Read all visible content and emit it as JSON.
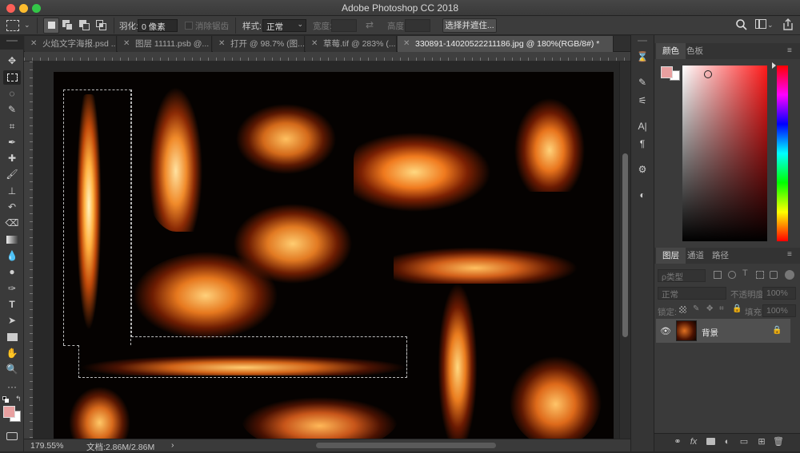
{
  "app": {
    "window_title": "Adobe Photoshop CC 2018",
    "traffic_lights": {
      "close": "#fc5f57",
      "minimize": "#fdbc2e",
      "zoom": "#33c748"
    }
  },
  "options_bar": {
    "feather_label": "羽化:",
    "feather_value": "0 像素",
    "antialias_label": "消除锯齿",
    "style_label": "样式:",
    "style_value": "正常",
    "width_label": "宽度:",
    "height_label": "高度:",
    "select_mask_button": "选择并遮住..."
  },
  "tabs": [
    {
      "label": "火焰文字海报.psd ..."
    },
    {
      "label": "图层 11111.psb @..."
    },
    {
      "label": "打开 @ 98.7% (图..."
    },
    {
      "label": "草莓.tif @ 283% (..."
    },
    {
      "label": "330891-14020522211186.jpg @ 180%(RGB/8#) *"
    }
  ],
  "status_bar": {
    "zoom": "179.55%",
    "doc_info": "文档:2.86M/2.86M",
    "arrow": "›"
  },
  "color_panel": {
    "tab_color": "颜色",
    "tab_swatches": "色板",
    "foreground_color": "#e8a0a0",
    "hue_base": "#ff1a1a"
  },
  "layers_panel": {
    "tab_layers": "图层",
    "tab_channels": "通道",
    "tab_paths": "路径",
    "filter_label": "ρ类型",
    "blend_mode": "正常",
    "opacity_label": "不透明度:",
    "opacity_value": "100%",
    "lock_label": "锁定:",
    "fill_label": "填充:",
    "fill_value": "100%",
    "layer_name": "背景"
  },
  "colors": {
    "accent_bg": "#3a3a3a",
    "canvas_bg": "#050201",
    "flame_core": "#fff2b0",
    "flame_mid": "#ff9a2a",
    "flame_edge": "#a02a05"
  }
}
